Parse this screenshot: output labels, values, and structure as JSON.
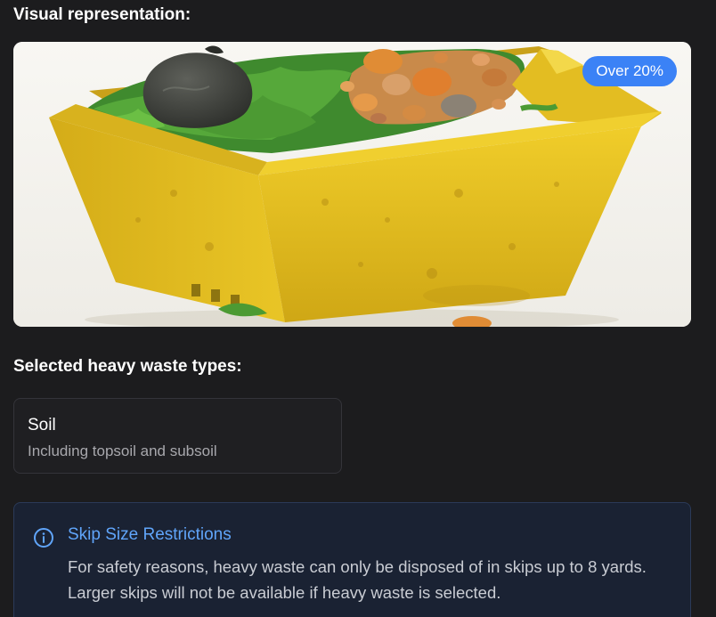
{
  "visual": {
    "heading": "Visual representation:",
    "badge": "Over 20%",
    "image_description_icon": "skip-photo"
  },
  "selected_types": {
    "heading": "Selected heavy waste types:",
    "items": [
      {
        "title": "Soil",
        "description": "Including topsoil and subsoil"
      }
    ]
  },
  "notice": {
    "icon": "info-icon",
    "title": "Skip Size Restrictions",
    "body": "For safety reasons, heavy waste can only be disposed of in skips up to 8 yards. Larger skips will not be available if heavy waste is selected."
  },
  "colors": {
    "background": "#1c1c1e",
    "badge": "#3b82f6",
    "notice_title": "#60a5fa",
    "skip_yellow": "#e8c21f"
  }
}
